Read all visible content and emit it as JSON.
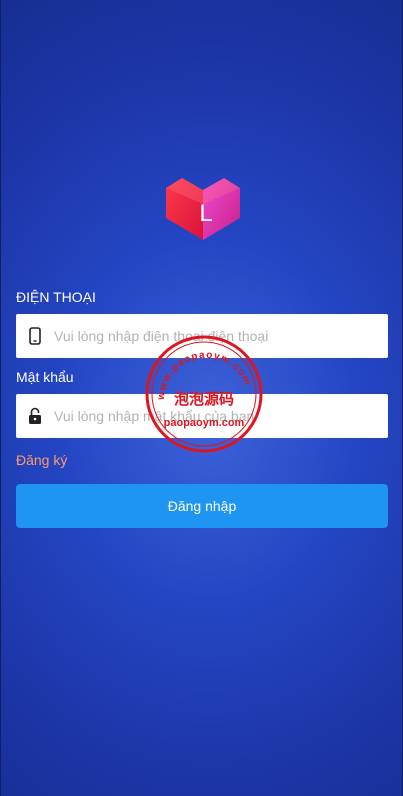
{
  "logo": {
    "letter": "L",
    "colors": {
      "primary": "#f0234a",
      "accent": "#e83aa8"
    }
  },
  "phone": {
    "label": "ĐIỆN THOẠI",
    "placeholder": "Vui lòng nhập điện thoại điện thoại",
    "value": "",
    "icon": "phone-icon"
  },
  "password": {
    "label": "Mật khẩu",
    "placeholder": "Vui lòng nhập mật khẩu của bạn",
    "value": "",
    "icon": "lock-icon"
  },
  "register_link": "Đăng ký",
  "login_button": "Đăng nhập",
  "watermark": {
    "title": "泡泡源码",
    "site": "paopaoym.com",
    "ring_top": "www.paopaoym.com"
  },
  "colors": {
    "background": "#2446c4",
    "button": "#1e95f2",
    "register_link": "#ff9a6b",
    "watermark": "#e0141e"
  }
}
